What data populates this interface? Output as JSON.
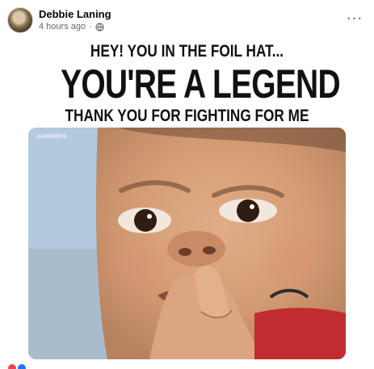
{
  "post": {
    "author": "Debbie Laning",
    "time": "4 hours ago",
    "separator": "·",
    "privacy_icon": "globe-icon",
    "more_icon": "more-horizontal-icon",
    "more_label": "···"
  },
  "meme": {
    "line1": "HEY! YOU IN THE FOIL  HAT...",
    "line2": "YOU'RE A LEGEND",
    "line3": "THANK YOU FOR FIGHTING FOR ME",
    "watermark": "JAMEMES"
  },
  "reactions": {
    "icons": [
      "love-reaction-icon",
      "like-reaction-icon"
    ]
  },
  "colors": {
    "author": "#050505",
    "meta": "#65676b",
    "meme_text": "#111111",
    "love": "#f33e58",
    "like": "#1877f2"
  }
}
